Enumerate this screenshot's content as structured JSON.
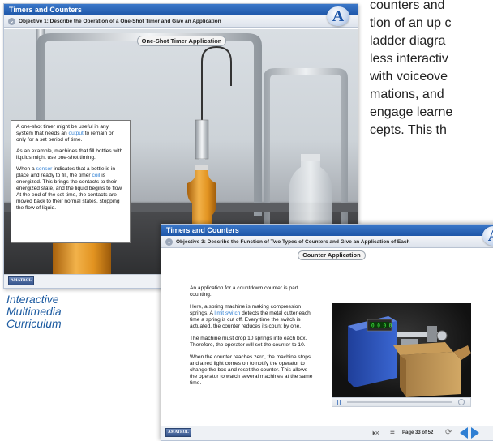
{
  "window1": {
    "app_title": "Timers and Counters",
    "objective": "Objective 1: Describe the Operation of a One-Shot Timer and Give an Application",
    "section_title": "One-Shot Timer Application",
    "logo_letter": "A",
    "brand": "AMATROL",
    "paragraphs": [
      [
        "A one-shot timer might be useful in any system that needs an ",
        "output",
        " to remain on only for a set period of time."
      ],
      [
        "As an example, machines that fill bottles with liquids might use one-shot timing.",
        "",
        ""
      ],
      [
        "When a ",
        "sensor",
        " indicates that a bottle is in place and ready to fill, the timer ",
        "coil",
        " is energized. This brings the contacts to their energized state, and the liquid begins to flow. At the end of the set time, the contacts are moved back to their normal states, stopping the flow of liquid."
      ]
    ]
  },
  "caption": {
    "line1": "Interactive",
    "line2": "Multimedia",
    "line3": "Curriculum"
  },
  "right_text": {
    "lines": [
      "counters and",
      "tion of an up c",
      "ladder diagra",
      "less interactiv",
      "with voiceove",
      "mations, and",
      "engage learne",
      "cepts. This th"
    ]
  },
  "window2": {
    "app_title": "Timers and Counters",
    "objective": "Objective 3: Describe the Function of Two Types of Counters and Give an Application of Each",
    "section_title": "Counter Application",
    "logo_letter": "A",
    "brand": "AMATROL",
    "p1": "An application for a countdown counter is part counting.",
    "p2a": "Here, a spring machine is making compression springs. A ",
    "p2_link": "limit switch",
    "p2b": " detects the metal cutter each time a spring is cut off. Every time the switch is actuated, the counter reduces its count by one.",
    "p3": "The machine must drop 10 springs into each box. Therefore, the operator will set the counter to 10.",
    "p4": "When the counter reaches zero, the machine stops and a red light comes on to notify the operator to change the box and reset the counter. This allows the operator to watch several machines at the same time.",
    "counter_display": "0 0 0 0",
    "page_indicator": "Page 33 of 52",
    "icons": [
      "mute-icon",
      "menu-icon",
      "replay-icon",
      "previous-icon",
      "next-icon",
      "pause-icon"
    ]
  }
}
